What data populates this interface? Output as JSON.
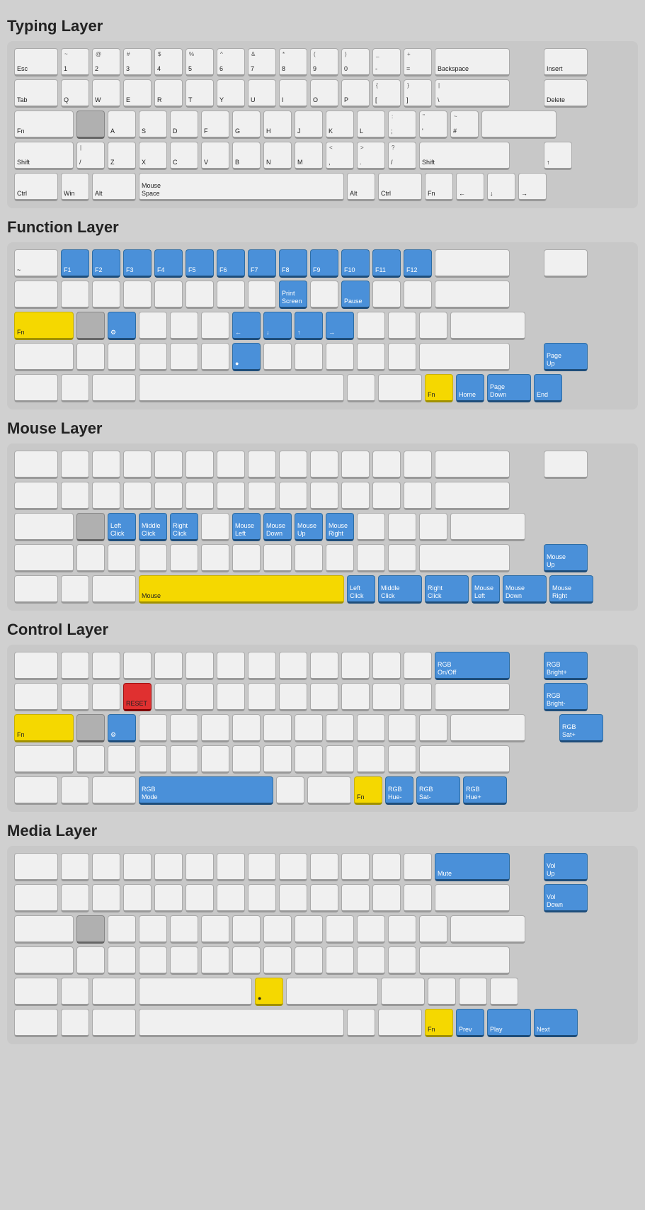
{
  "sections": [
    {
      "id": "typing",
      "title": "Typing Layer"
    },
    {
      "id": "function",
      "title": "Function Layer"
    },
    {
      "id": "mouse",
      "title": "Mouse Layer"
    },
    {
      "id": "control",
      "title": "Control Layer"
    },
    {
      "id": "media",
      "title": "Media Layer"
    }
  ]
}
